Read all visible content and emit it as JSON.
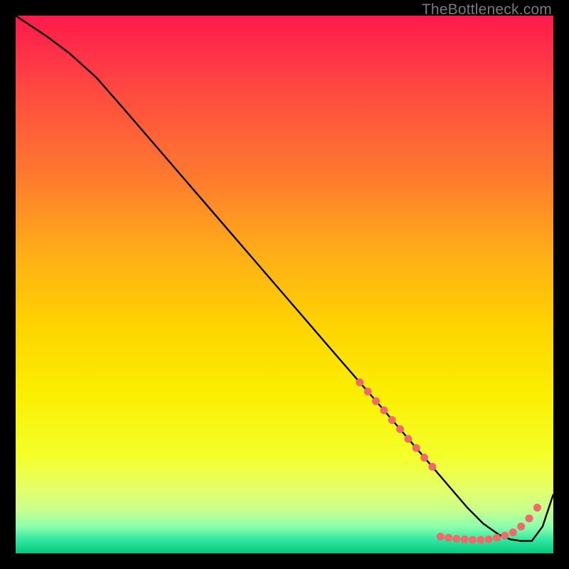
{
  "watermark": "TheBottleneck.com",
  "chart_data": {
    "type": "line",
    "title": "",
    "xlabel": "",
    "ylabel": "",
    "xlim": [
      0,
      100
    ],
    "ylim": [
      0,
      100
    ],
    "grid": false,
    "background_gradient": {
      "stops": [
        {
          "offset": 0.0,
          "color": "#ff1a4b"
        },
        {
          "offset": 0.05,
          "color": "#ff2a4a"
        },
        {
          "offset": 0.15,
          "color": "#ff4d3f"
        },
        {
          "offset": 0.3,
          "color": "#ff7a2e"
        },
        {
          "offset": 0.45,
          "color": "#ffb017"
        },
        {
          "offset": 0.58,
          "color": "#ffd400"
        },
        {
          "offset": 0.7,
          "color": "#fbee00"
        },
        {
          "offset": 0.82,
          "color": "#f4ff2a"
        },
        {
          "offset": 0.88,
          "color": "#e4ff68"
        },
        {
          "offset": 0.92,
          "color": "#c7ff8e"
        },
        {
          "offset": 0.95,
          "color": "#8dffad"
        },
        {
          "offset": 0.975,
          "color": "#34e6a0"
        },
        {
          "offset": 1.0,
          "color": "#00c97f"
        }
      ]
    },
    "series": [
      {
        "name": "bottleneck-curve",
        "color": "#000000",
        "x": [
          0,
          3,
          6,
          10,
          15,
          20,
          25,
          30,
          35,
          40,
          45,
          50,
          55,
          60,
          64,
          68,
          72,
          75,
          78,
          81,
          84,
          87,
          90,
          92,
          94,
          96,
          98,
          100
        ],
        "y": [
          100,
          98,
          96,
          93,
          88.5,
          82.8,
          77.0,
          71.2,
          65.4,
          59.6,
          53.8,
          48.0,
          42.2,
          36.4,
          31.8,
          27.2,
          22.5,
          19.0,
          15.5,
          12.0,
          8.5,
          5.5,
          3.4,
          2.6,
          2.3,
          2.3,
          5.0,
          11.0
        ]
      }
    ],
    "markers": {
      "name": "highlight-dots",
      "color": "#ef6a6a",
      "radius": 5.5,
      "points": [
        {
          "x": 64.0,
          "y": 31.8
        },
        {
          "x": 65.5,
          "y": 30.1
        },
        {
          "x": 67.0,
          "y": 28.3
        },
        {
          "x": 68.5,
          "y": 26.6
        },
        {
          "x": 70.0,
          "y": 24.8
        },
        {
          "x": 71.5,
          "y": 23.1
        },
        {
          "x": 73.0,
          "y": 21.3
        },
        {
          "x": 74.5,
          "y": 19.6
        },
        {
          "x": 76.0,
          "y": 17.8
        },
        {
          "x": 77.5,
          "y": 16.1
        },
        {
          "x": 79.0,
          "y": 3.1
        },
        {
          "x": 80.5,
          "y": 2.9
        },
        {
          "x": 82.0,
          "y": 2.7
        },
        {
          "x": 83.5,
          "y": 2.6
        },
        {
          "x": 85.0,
          "y": 2.5
        },
        {
          "x": 86.5,
          "y": 2.5
        },
        {
          "x": 88.0,
          "y": 2.6
        },
        {
          "x": 89.5,
          "y": 2.9
        },
        {
          "x": 91.0,
          "y": 3.3
        },
        {
          "x": 92.5,
          "y": 3.9
        },
        {
          "x": 94.0,
          "y": 5.0
        },
        {
          "x": 95.5,
          "y": 6.5
        },
        {
          "x": 97.0,
          "y": 8.5
        }
      ]
    }
  }
}
